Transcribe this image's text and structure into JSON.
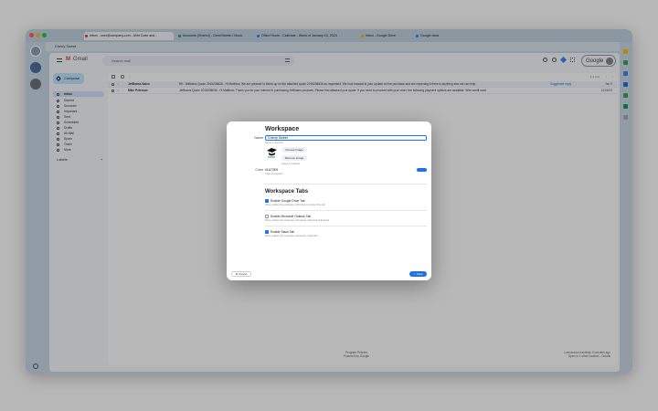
{
  "browser": {
    "tabs": [
      {
        "label": "Inbox - user@company.com - Mint Code and..."
      },
      {
        "label": "Accounts (Shared) - Omni Meetin / Mock"
      },
      {
        "label": "Office Hours - Calendar - Week of January 15, 2024"
      },
      {
        "label": "Inbox - Google Drive"
      },
      {
        "label": "Google docs"
      }
    ],
    "address": "Cherry Sweet",
    "colors": {
      "close": "#ff5f57",
      "min": "#febc2e",
      "max": "#28c840"
    }
  },
  "gmail": {
    "logo_text": "Gmail",
    "search_placeholder": "Search mail",
    "account_label": "Google",
    "compose_label": "Compose",
    "nav": [
      {
        "label": "Inbox",
        "selected": true
      },
      {
        "label": "Starred"
      },
      {
        "label": "Snoozed"
      },
      {
        "label": "Important"
      },
      {
        "label": "Sent"
      },
      {
        "label": "Scheduled"
      },
      {
        "label": "Drafts"
      },
      {
        "label": "All Mail"
      },
      {
        "label": "Spam"
      },
      {
        "label": "Trash"
      },
      {
        "label": "More"
      }
    ],
    "labels_heading": "Labels",
    "pager": "1-2 of 2",
    "emails": [
      {
        "from": "JetBrains Sales",
        "subject": "RE: JetBrains Quote 2015208636 - Hi Matthew, We are pleased to follow up on the attached quote 2015208636 as requested. We look forward to your update on the purchase and are expecting it there is anything else we can help",
        "label": "Suggested reply",
        "date": "Jan 9"
      },
      {
        "from": "Mike Peterson",
        "subject": "JetBrains Quote 2015208636 - Hi Matthew, Thank you for your interest in purchasing JetBrains products. Please find attached your quote. If you need to proceed with your order, the following payment options are available. Wire credit card.",
        "label": "",
        "date": "12/26/23"
      }
    ],
    "footer_center": [
      "Program Policies",
      "Powered by Google"
    ],
    "footer_right": [
      "Last account activity: 0 minutes ago",
      "Open in 1 other location - Details"
    ]
  },
  "dialog": {
    "title": "Workspace",
    "name_label": "Name",
    "name_value": "Cherry Sweet",
    "name_hint": "Name is required",
    "choose_image": "Choose Image",
    "remove_image": "Remove Image",
    "image_hint": "Image is required",
    "color_label": "Color",
    "color_value": "#1A73E8",
    "color_hint": "Color is required",
    "tabs_title": "Workspace Tabs",
    "options": [
      {
        "label": "Enable Google Drive Tab",
        "desc": "When enabled, this workspace will include a Google Drive tab",
        "checked": true
      },
      {
        "label": "Enable Microsoft Outlook Tab",
        "desc": "When enabled, this workspace will include a Microsoft Outlook tab",
        "checked": false
      },
      {
        "label": "Enable Slack Tab",
        "desc": "When enabled, this workspace will include a Slack tab",
        "checked": true
      }
    ],
    "cancel_label": "Cancel",
    "save_label": "Save"
  }
}
